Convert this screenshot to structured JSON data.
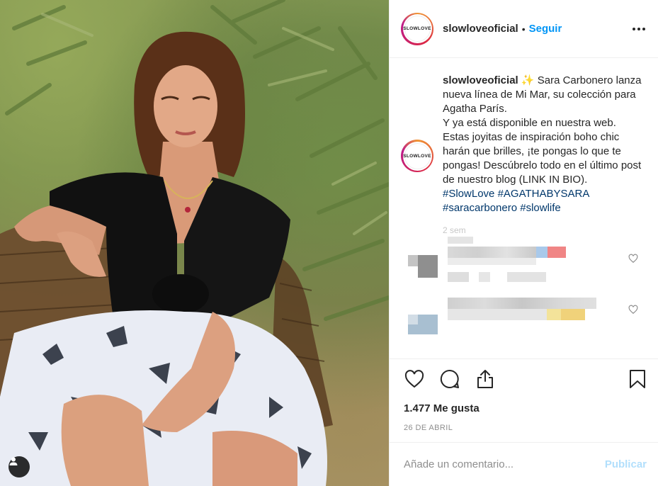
{
  "header": {
    "username": "slowloveoficial",
    "separator": "•",
    "follow_label": "Seguir",
    "avatar_text": "SLOWLOVE"
  },
  "caption": {
    "username": "slowloveoficial",
    "emoji": "✨",
    "line1": " Sara Carbonero lanza nueva línea de Mi Mar, su colección para Agatha París.",
    "line2": "Y ya está disponible en nuestra web.",
    "line3": "Estas joyitas de inspiración boho chic harán que brilles, ¡te pongas lo que te pongas! Descúbrelo todo en el último post de nuestro blog (LINK IN BIO).",
    "hashtags": [
      "#SlowLove",
      "#AGATHABYSARA",
      "#saracarbonero",
      "#slowlife"
    ],
    "time": "2 sem"
  },
  "actions": {
    "likes": "1.477 Me gusta",
    "date": "26 DE ABRIL"
  },
  "comment_box": {
    "placeholder": "Añade un comentario...",
    "publish_label": "Publicar"
  },
  "icons": {
    "more": "more-dots-icon",
    "like": "heart-icon",
    "comment": "comment-bubble-icon",
    "share": "share-icon",
    "save": "bookmark-icon",
    "user_tag": "user-tag-icon"
  },
  "colors": {
    "accent": "#0095f6",
    "hashtag": "#00376b",
    "publish_disabled": "#b2dffc",
    "muted": "#8e8e8e"
  }
}
